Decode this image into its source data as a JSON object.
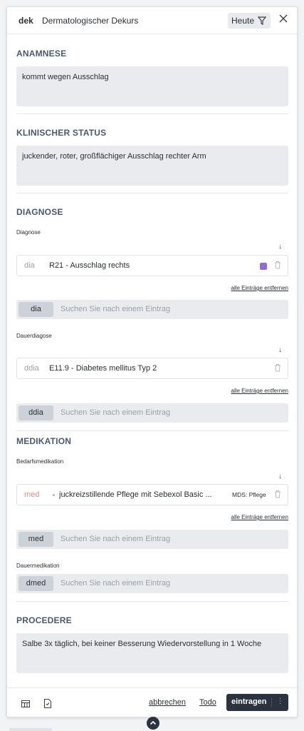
{
  "header": {
    "code": "dek",
    "title": "Dermatologischer Dekurs",
    "today_label": "Heute"
  },
  "anamnese": {
    "title": "ANAMNESE",
    "text": "kommt wegen Ausschlag"
  },
  "status": {
    "title": "KLINISCHER STATUS",
    "text": "juckender, roter, großflächiger Ausschlag rechter Arm"
  },
  "diagnose": {
    "title": "DIAGNOSE",
    "diagnose_label": "Diagnose",
    "diagnose_entry": {
      "code": "dia",
      "text": "R21 - Ausschlag rechts",
      "color": "#8e6cd9"
    },
    "diagnose_remove": "alle Einträge entfernen",
    "diagnose_search": {
      "tag": "dia",
      "placeholder": "Suchen Sie nach einem Eintrag"
    },
    "dauer_label": "Dauerdiagose",
    "dauer_entry": {
      "code": "ddia",
      "text": "E11.9 - Diabetes mellitus Typ 2"
    },
    "dauer_remove": "alle Einträge entfernen",
    "dauer_search": {
      "tag": "ddia",
      "placeholder": "Suchen Sie nach einem Eintrag"
    }
  },
  "medikation": {
    "title": "MEDIKATION",
    "bedarf_label": "Bedarfsmedikation",
    "bedarf_entry": {
      "code": "med",
      "text": "juckreizstillende Pflege mit Sebexol Basic ...",
      "badge": "MDS: Pflege"
    },
    "bedarf_remove": "alle Einträge entfernen",
    "bedarf_search": {
      "tag": "med",
      "placeholder": "Suchen Sie nach einem Eintrag"
    },
    "dauer_label": "Dauermedikation",
    "dauer_search": {
      "tag": "dmed",
      "placeholder": "Suchen Sie nach einem Eintrag"
    }
  },
  "procedere": {
    "title": "PROCEDERE",
    "text": "Salbe 3x täglich, bei keiner Besserung Wiedervorstellung in 1 Woche"
  },
  "footer": {
    "cancel_label": "abbrechen",
    "todo_label": "Todo",
    "submit_label": "eintragen",
    "more_label": "⋮"
  },
  "icons": {
    "sort": "↓"
  }
}
